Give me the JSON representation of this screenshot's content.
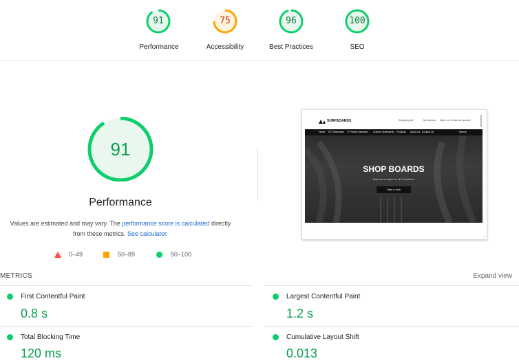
{
  "categories": [
    {
      "label": "Performance",
      "score": "91",
      "value": 91,
      "color": "#0cce6b",
      "bg": "#e8f7ee",
      "text": "#0c7a3f"
    },
    {
      "label": "Accessibility",
      "score": "75",
      "value": 75,
      "color": "#ffa400",
      "bg": "#fff3e0",
      "text": "#c33300"
    },
    {
      "label": "Best Practices",
      "score": "96",
      "value": 96,
      "color": "#0cce6b",
      "bg": "#e8f7ee",
      "text": "#0c7a3f"
    },
    {
      "label": "SEO",
      "score": "100",
      "value": 100,
      "color": "#0cce6b",
      "bg": "#e8f7ee",
      "text": "#0c7a3f"
    }
  ],
  "main": {
    "score": "91",
    "value": 91,
    "title": "Performance",
    "desc_part1": "Values are estimated and may vary. The ",
    "desc_link1": "performance score is calculated",
    "desc_part2": " directly from these metrics. ",
    "desc_link2": "See calculator."
  },
  "legend": {
    "fail": "0–49",
    "average": "50–89",
    "pass": "90–100"
  },
  "metrics": {
    "title": "METRICS",
    "expand": "Expand view",
    "items": [
      {
        "label": "First Contentful Paint",
        "value": "0.8 s"
      },
      {
        "label": "Largest Contentful Paint",
        "value": "1.2 s"
      },
      {
        "label": "Total Blocking Time",
        "value": "120 ms"
      },
      {
        "label": "Cumulative Layout Shift",
        "value": "0.013"
      }
    ]
  },
  "thumbnail": {
    "logo": "SURFBOARDS",
    "cart": "Shopping cart",
    "account": "My account",
    "signin": "Sign in or Create an account",
    "nav": [
      "Home",
      "DF Surfboards",
      "E Primal Collection",
      "Custom Surfboards",
      "Products",
      "About Us",
      "Contact Us"
    ],
    "search": "Search",
    "hero_title": "SHOP BOARDS",
    "hero_sub": "Discover shapes for all Conditions",
    "hero_button": "Take a look"
  },
  "colors": {
    "pass": "#0cce6b",
    "average": "#ffa400",
    "fail": "#ff4e42",
    "link": "#1967d2"
  }
}
